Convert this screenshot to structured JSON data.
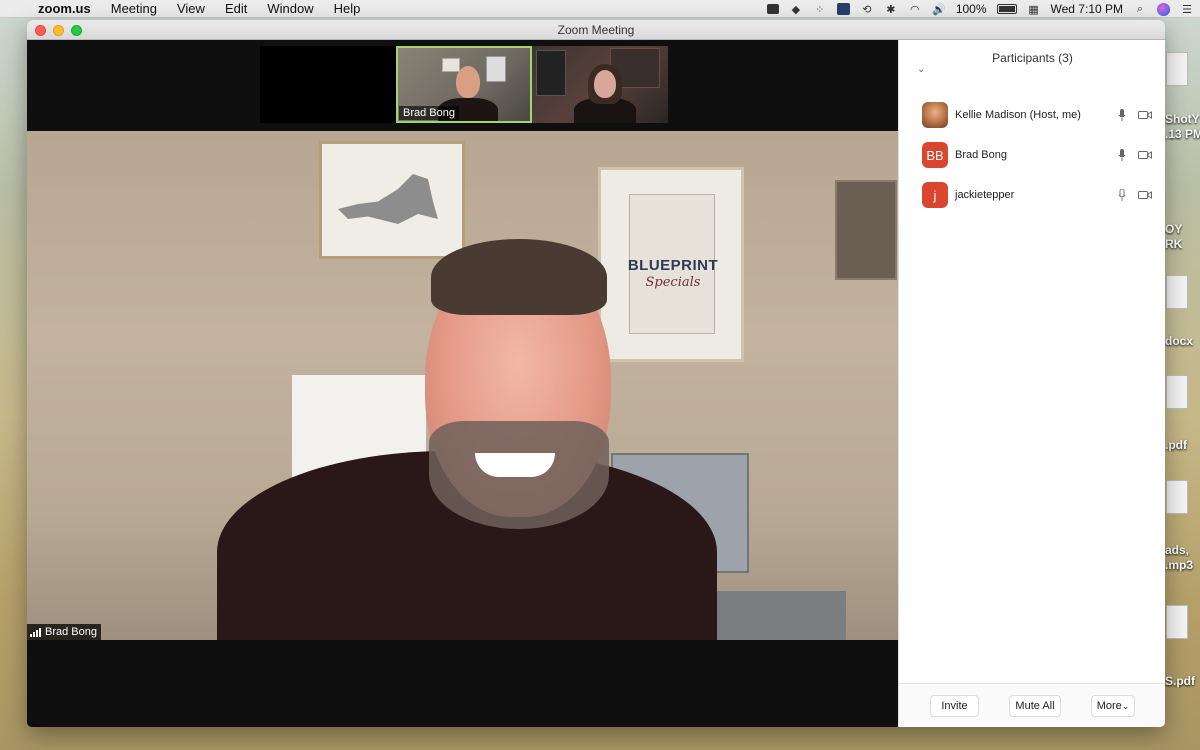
{
  "menubar": {
    "app_name": "zoom.us",
    "menus": [
      "Meeting",
      "View",
      "Edit",
      "Window",
      "Help"
    ],
    "battery": "100%",
    "clock": "Wed 7:10 PM"
  },
  "desktop": {
    "file_labels": [
      "ShotY",
      ".13 PM",
      "OY",
      "RK",
      "docx",
      ".pdf",
      "ads,",
      ".mp3",
      "S.pdf"
    ]
  },
  "window": {
    "title": "Zoom Meeting"
  },
  "gallery": {
    "thumbnails": [
      {
        "name": ""
      },
      {
        "name": "Brad Bong"
      },
      {
        "name": ""
      }
    ]
  },
  "main_video": {
    "speaker_name": "Brad Bong",
    "poster_title": "BLUEPRINT",
    "poster_subtitle": "Specials"
  },
  "participants": {
    "header": "Participants (3)",
    "list": [
      {
        "name": "Kellie Madison (Host, me)",
        "initials": ""
      },
      {
        "name": "Brad Bong",
        "initials": "BB"
      },
      {
        "name": "jackietepper",
        "initials": "j"
      }
    ],
    "buttons": {
      "invite": "Invite",
      "mute_all": "Mute All",
      "more": "More"
    }
  },
  "colors": {
    "active_speaker_border": "#a8d26a",
    "avatar_red": "#d9452f",
    "traffic_close": "#fe5f57",
    "traffic_min": "#febc2e",
    "traffic_max": "#28c840"
  }
}
